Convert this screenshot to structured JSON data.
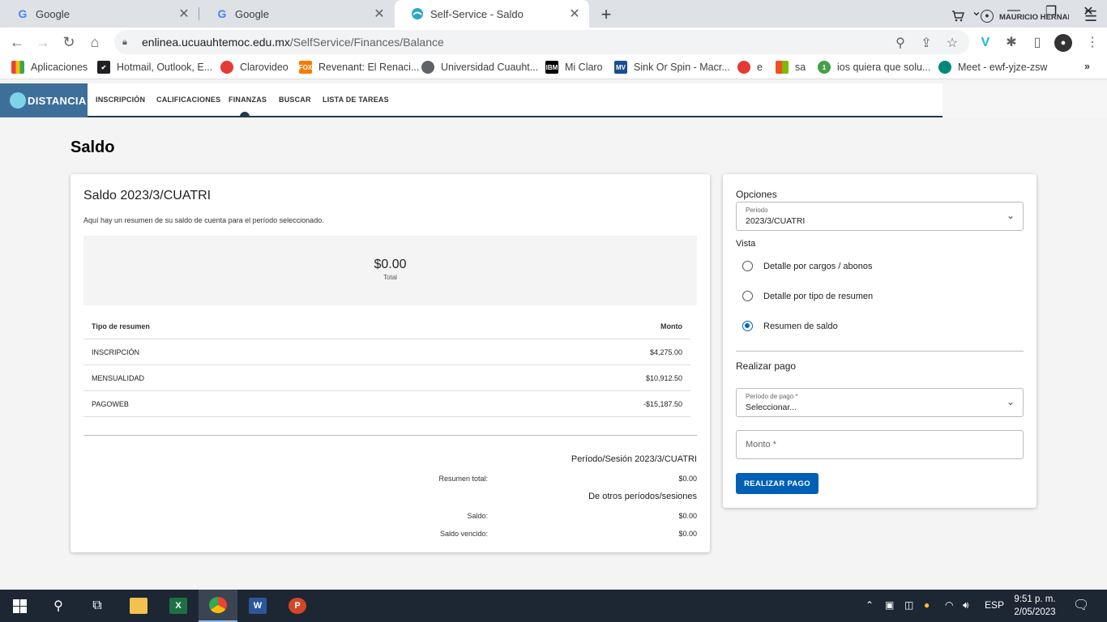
{
  "browser": {
    "tabs": [
      {
        "title": "Google",
        "icon": "google-icon",
        "active": false
      },
      {
        "title": "Google",
        "icon": "google-icon",
        "active": false
      },
      {
        "title": "Self-Service - Saldo",
        "icon": "self-service-icon",
        "active": true
      }
    ],
    "url_host": "enlinea.ucuauhtemoc.edu.mx",
    "url_path": "/SelfService/Finances/Balance",
    "bookmarks": [
      {
        "label": "Aplicaciones",
        "icon": "apps-icon",
        "color": "#4285f4"
      },
      {
        "label": "Hotmail, Outlook, E...",
        "icon": "outlook-icon",
        "color": "#202124"
      },
      {
        "label": "Clarovideo",
        "icon": "clarovideo-icon",
        "color": "#e53935"
      },
      {
        "label": "Revenant: El Renaci...",
        "icon": "fox-icon",
        "color": "#f57c00"
      },
      {
        "label": "Universidad Cuauht...",
        "icon": "globe-icon",
        "color": "#5f6368"
      },
      {
        "label": "Mi Claro",
        "icon": "ibm-icon",
        "color": "#000000"
      },
      {
        "label": "Sink Or Spin - Macr...",
        "icon": "mv-icon",
        "color": "#1a4d8f"
      },
      {
        "label": "e",
        "icon": "opera-icon",
        "color": "#e53935"
      },
      {
        "label": "sa",
        "icon": "windows-icon",
        "color": "#7cbb00"
      },
      {
        "label": "ios quiera que solu...",
        "icon": "number-one-icon",
        "color": "#43a047"
      },
      {
        "label": "Meet - ewf-yjze-zsw",
        "icon": "meet-icon",
        "color": "#00897b"
      }
    ]
  },
  "app": {
    "logo_text": "DISTANCIA",
    "nav": [
      "INSCRIPCIÓN",
      "CALIFICACIONES",
      "FINANZAS",
      "BUSCAR",
      "LISTA DE TAREAS"
    ],
    "user_name": "MAURICIO HERNAI"
  },
  "page": {
    "title": "Saldo",
    "balance": {
      "heading": "Saldo 2023/3/CUATRI",
      "description": "Aquí hay un resumen de su saldo de cuenta para el período seleccionado.",
      "total_amount": "$0.00",
      "total_label": "Total",
      "table": {
        "headers": [
          "Tipo de resumen",
          "Monto"
        ],
        "rows": [
          [
            "INSCRIPCIÓN",
            "$4,275.00"
          ],
          [
            "MENSUALIDAD",
            "$10,912.50"
          ],
          [
            "PAGOWEB",
            "-$15,187.50"
          ]
        ]
      },
      "period_section": "Período/Sesión 2023/3/CUATRI",
      "summary_total_label": "Resumen total:",
      "summary_total_value": "$0.00",
      "other_section": "De otros períodos/sesiones",
      "saldo_label": "Saldo:",
      "saldo_value": "$0.00",
      "overdue_label": "Saldo vencido:",
      "overdue_value": "$0.00"
    },
    "options": {
      "title": "Opciones",
      "period_label": "Periodo",
      "period_value": "2023/3/CUATRI",
      "view_label": "Vista",
      "views": [
        {
          "label": "Detalle por cargos / abonos",
          "selected": false
        },
        {
          "label": "Detalle por tipo de resumen",
          "selected": false
        },
        {
          "label": "Resumen de saldo",
          "selected": true
        }
      ],
      "payment_title": "Realizar pago",
      "payment_period_label": "Período de pago *",
      "payment_period_value": "Seleccionar...",
      "amount_placeholder": "Monto *",
      "pay_button": "REALIZAR PAGO"
    }
  },
  "taskbar": {
    "language": "ESP",
    "time": "9:51 p. m.",
    "date": "2/05/2023"
  },
  "colors": {
    "accent": "#0060b6",
    "header_line": "#1f3a4d",
    "logo_bg": "#3e6f9a"
  }
}
